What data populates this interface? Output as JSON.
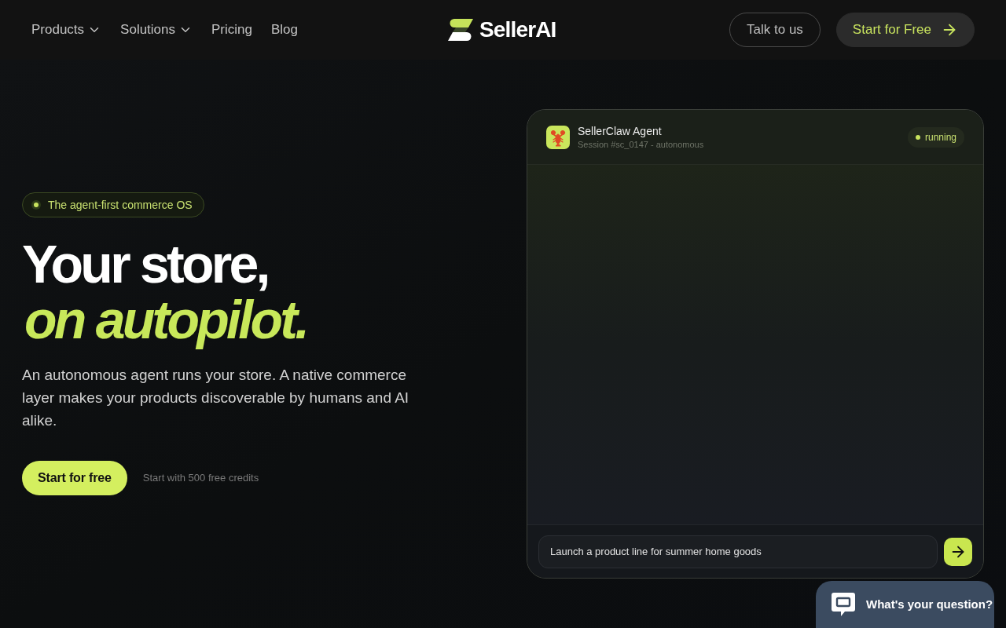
{
  "nav": {
    "links": [
      {
        "label": "Products",
        "dropdown": true
      },
      {
        "label": "Solutions",
        "dropdown": true
      },
      {
        "label": "Pricing",
        "dropdown": false
      },
      {
        "label": "Blog",
        "dropdown": false
      }
    ],
    "logo": "SellerAI",
    "buttons": [
      {
        "label": "Talk to us",
        "kind": "outline"
      },
      {
        "label": "Start for Free",
        "kind": "filled"
      }
    ]
  },
  "hero": {
    "badge": "The agent-first commerce OS",
    "title_line_1": "Your store,",
    "title_line_2": "on autopilot.",
    "description": "An autonomous agent runs your store. A native commerce layer makes your products discoverable by humans and AI alike.",
    "cta": "Start for free",
    "cta_note": "Start with 500 free credits"
  },
  "agent_panel": {
    "name": "SellerClaw Agent",
    "session": "Session #sc_0147 - autonomous",
    "status": "running",
    "prompt": {
      "value": "Launch a product line for summer home goods"
    }
  },
  "chat_widget": {
    "label": "What's your question?"
  }
}
